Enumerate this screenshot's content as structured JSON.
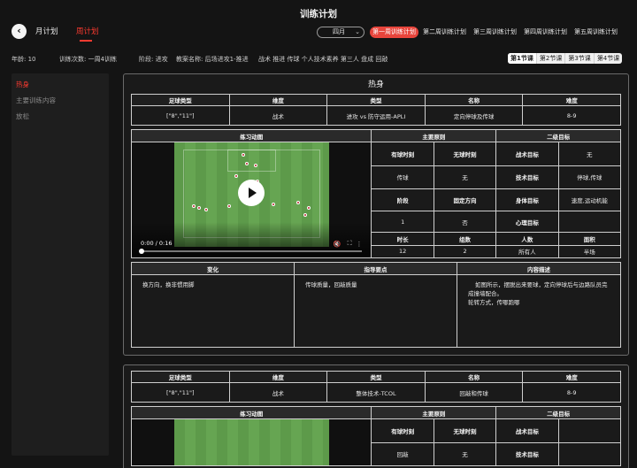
{
  "header": {
    "title": "训练计划",
    "back_icon": "back-icon"
  },
  "tabs": {
    "month": "月计划",
    "week": "周计划",
    "active": "week"
  },
  "month_select": {
    "value": "四月"
  },
  "week_tabs": [
    "第一周训练计划",
    "第二周训练计划",
    "第三周训练计划",
    "第四周训练计划",
    "第五周训练计划"
  ],
  "info": {
    "age": "年龄:  10",
    "count": "训练次数:  一周4训练",
    "stage": "阶段:  进攻",
    "plan_name": "教案名称:  后场进攻1-推进",
    "topics": "战术  推进  传球  个人技术素养  第三人  盘成  回敲"
  },
  "lesson_tabs": [
    "第1节课",
    "第2节课",
    "第3节课",
    "第4节课"
  ],
  "sidebar": {
    "items": [
      "热身",
      "主要训练内容",
      "放松"
    ],
    "active": 0
  },
  "headers": {
    "foot_type": "足球类型",
    "dimension": "维度",
    "type": "类型",
    "name": "名称",
    "difficulty": "难度",
    "animation": "练习动图",
    "principles": "主要原则",
    "secondary": "二级目标",
    "with_ball": "有球时刻",
    "without_ball": "无球时刻",
    "tactical_goal": "战术目标",
    "technical_goal": "技术目标",
    "stage": "阶段",
    "fixed_direction": "固定方向",
    "physical_goal": "身体目标",
    "mental_goal": "心理目标",
    "duration": "时长",
    "groups": "组数",
    "people": "人数",
    "area": "面积",
    "variation": "变化",
    "coaching_points": "指导要点",
    "content_desc": "内容描述"
  },
  "section1": {
    "title": "热身",
    "foot_type": "[\"8\",\"11\"]",
    "dimension": "战术",
    "type": "进攻 vs 防守运用-APLI",
    "name": "定向停球及传球",
    "difficulty": "8-9",
    "with_ball": "传球",
    "without_ball": "无",
    "tactical_goal": "无",
    "technical_goal": "停球,传球",
    "stage": "1",
    "fixed_direction": "否",
    "physical_goal": "速度,运动机能",
    "mental_goal": "",
    "duration": "12",
    "groups": "2",
    "people": "所有人",
    "area": "半场",
    "variation": "换方向，换非惯用脚",
    "coaching_points": "传球质量，回敲质量",
    "content_desc_1": "如图所示，摆脱出来要球，定向停球后与边路队员完成撞墙配合。",
    "content_desc_2": "轮转方式，传哪跑哪",
    "video_time": "0:00 / 0:16"
  },
  "section2": {
    "foot_type": "[\"8\",\"11\"]",
    "dimension": "战术",
    "type": "整体技术-TCOL",
    "name": "回敲和传球",
    "difficulty": "8-9",
    "with_ball": "回敲",
    "without_ball": "无"
  }
}
